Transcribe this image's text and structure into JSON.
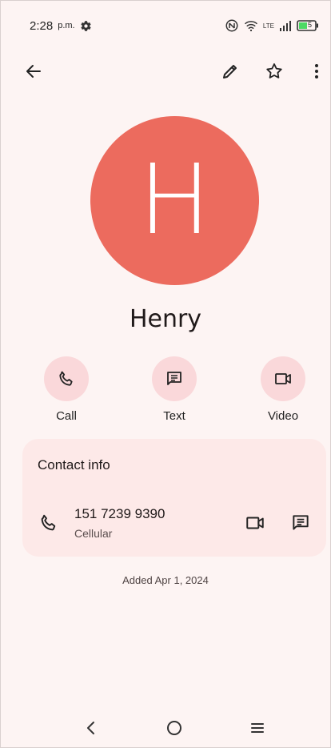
{
  "status_bar": {
    "time": "2:28",
    "ampm": "p.m.",
    "network": "LTE",
    "battery": "5"
  },
  "app_bar": {
    "back_icon": "arrow-left-icon",
    "edit_icon": "pencil-icon",
    "favorite_icon": "star-outline-icon",
    "more_icon": "more-vert-icon"
  },
  "contact": {
    "initial": "H",
    "name": "Henry",
    "avatar_color": "#ec6b5e"
  },
  "actions": [
    {
      "label": "Call",
      "icon": "phone-icon"
    },
    {
      "label": "Text",
      "icon": "message-icon"
    },
    {
      "label": "Video",
      "icon": "videocam-icon"
    }
  ],
  "contact_info": {
    "title": "Contact info",
    "phone": "151 7239 9390",
    "phone_type": "Cellular"
  },
  "added": "Added Apr 1, 2024",
  "nav": [
    "back",
    "home",
    "recents"
  ],
  "colors": {
    "background": "#fdf4f3",
    "action_circle": "#fad8da",
    "card": "#fde9e8"
  }
}
